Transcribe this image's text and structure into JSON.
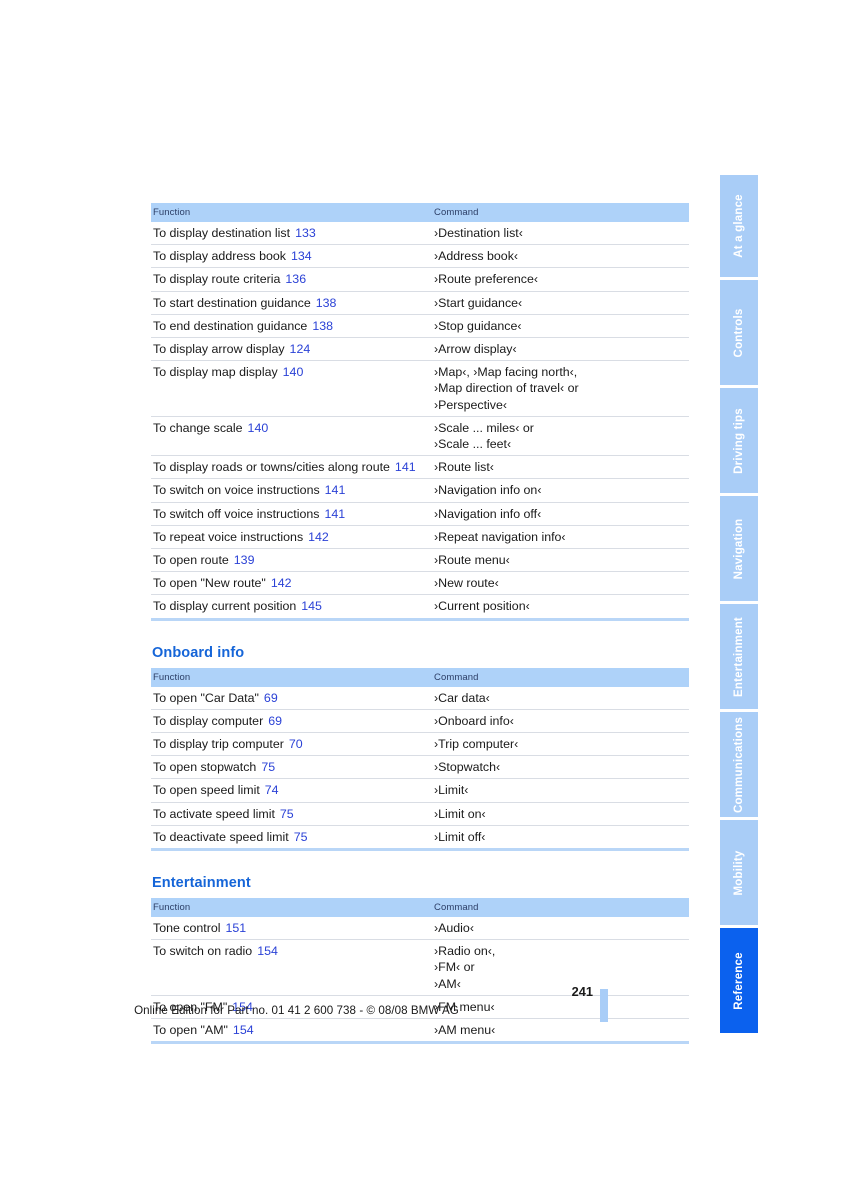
{
  "colors": {
    "header_band": "#aed2f9",
    "heading_blue": "#1565d8",
    "pageref_blue": "#2b42d6",
    "tab_inactive": "#a9cdf7",
    "tab_active": "#0b61ee",
    "rule_blue": "#b9d6f7"
  },
  "tables": [
    {
      "id": "navigation-commands",
      "heading": null,
      "columns": [
        "Function",
        "Command"
      ],
      "rows": [
        {
          "function": "To display destination list",
          "page": "133",
          "command": [
            "›Destination list‹"
          ]
        },
        {
          "function": "To display address book",
          "page": "134",
          "command": [
            "›Address book‹"
          ]
        },
        {
          "function": "To display route criteria",
          "page": "136",
          "command": [
            "›Route preference‹"
          ]
        },
        {
          "function": "To start destination guidance",
          "page": "138",
          "command": [
            "›Start guidance‹"
          ]
        },
        {
          "function": "To end destination guidance",
          "page": "138",
          "command": [
            "›Stop guidance‹"
          ]
        },
        {
          "function": "To display arrow display",
          "page": "124",
          "command": [
            "›Arrow display‹"
          ]
        },
        {
          "function": "To display map display",
          "page": "140",
          "command": [
            "›Map‹, ›Map facing north‹,",
            "›Map direction of travel‹ or",
            "›Perspective‹"
          ]
        },
        {
          "function": "To change scale",
          "page": "140",
          "command": [
            "›Scale ... miles‹ or",
            "›Scale ... feet‹"
          ]
        },
        {
          "function": "To display roads or towns/cities along route",
          "page": "141",
          "command": [
            "›Route list‹"
          ],
          "wide": true
        },
        {
          "function": "To switch on voice instructions",
          "page": "141",
          "command": [
            "›Navigation info on‹"
          ]
        },
        {
          "function": "To switch off voice instructions",
          "page": "141",
          "command": [
            "›Navigation info off‹"
          ]
        },
        {
          "function": "To repeat voice instructions",
          "page": "142",
          "command": [
            "›Repeat navigation info‹"
          ]
        },
        {
          "function": "To open route",
          "page": "139",
          "command": [
            "›Route menu‹"
          ]
        },
        {
          "function": "To open \"New route\"",
          "page": "142",
          "command": [
            "›New route‹"
          ]
        },
        {
          "function": "To display current position",
          "page": "145",
          "command": [
            "›Current position‹"
          ]
        }
      ]
    },
    {
      "id": "onboard-info-commands",
      "heading": "Onboard info",
      "columns": [
        "Function",
        "Command"
      ],
      "rows": [
        {
          "function": "To open \"Car Data\"",
          "page": "69",
          "command": [
            "›Car data‹"
          ]
        },
        {
          "function": "To display computer",
          "page": "69",
          "command": [
            "›Onboard info‹"
          ]
        },
        {
          "function": "To display trip computer",
          "page": "70",
          "command": [
            "›Trip computer‹"
          ]
        },
        {
          "function": "To open stopwatch",
          "page": "75",
          "command": [
            "›Stopwatch‹"
          ]
        },
        {
          "function": "To open speed limit",
          "page": "74",
          "command": [
            "›Limit‹"
          ]
        },
        {
          "function": "To activate speed limit",
          "page": "75",
          "command": [
            "›Limit on‹"
          ]
        },
        {
          "function": "To deactivate speed limit",
          "page": "75",
          "command": [
            "›Limit off‹"
          ]
        }
      ]
    },
    {
      "id": "entertainment-commands",
      "heading": "Entertainment",
      "columns": [
        "Function",
        "Command"
      ],
      "rows": [
        {
          "function": "Tone control",
          "page": "151",
          "command": [
            "›Audio‹"
          ]
        },
        {
          "function": "To switch on radio",
          "page": "154",
          "command": [
            "›Radio on‹,",
            "›FM‹ or",
            "›AM‹"
          ]
        },
        {
          "function": "To open \"FM\"",
          "page": "154",
          "command": [
            "›FM menu‹"
          ]
        },
        {
          "function": "To open \"AM\"",
          "page": "154",
          "command": [
            "›AM menu‹"
          ]
        }
      ]
    }
  ],
  "tabs": [
    {
      "label": "At a glance",
      "active": false
    },
    {
      "label": "Controls",
      "active": false
    },
    {
      "label": "Driving tips",
      "active": false
    },
    {
      "label": "Navigation",
      "active": false
    },
    {
      "label": "Entertainment",
      "active": false
    },
    {
      "label": "Communications",
      "active": false
    },
    {
      "label": "Mobility",
      "active": false
    },
    {
      "label": "Reference",
      "active": true
    }
  ],
  "footer": {
    "page_number": "241",
    "note": "Online Edition for Part no. 01 41 2 600 738 - © 08/08 BMW AG"
  }
}
